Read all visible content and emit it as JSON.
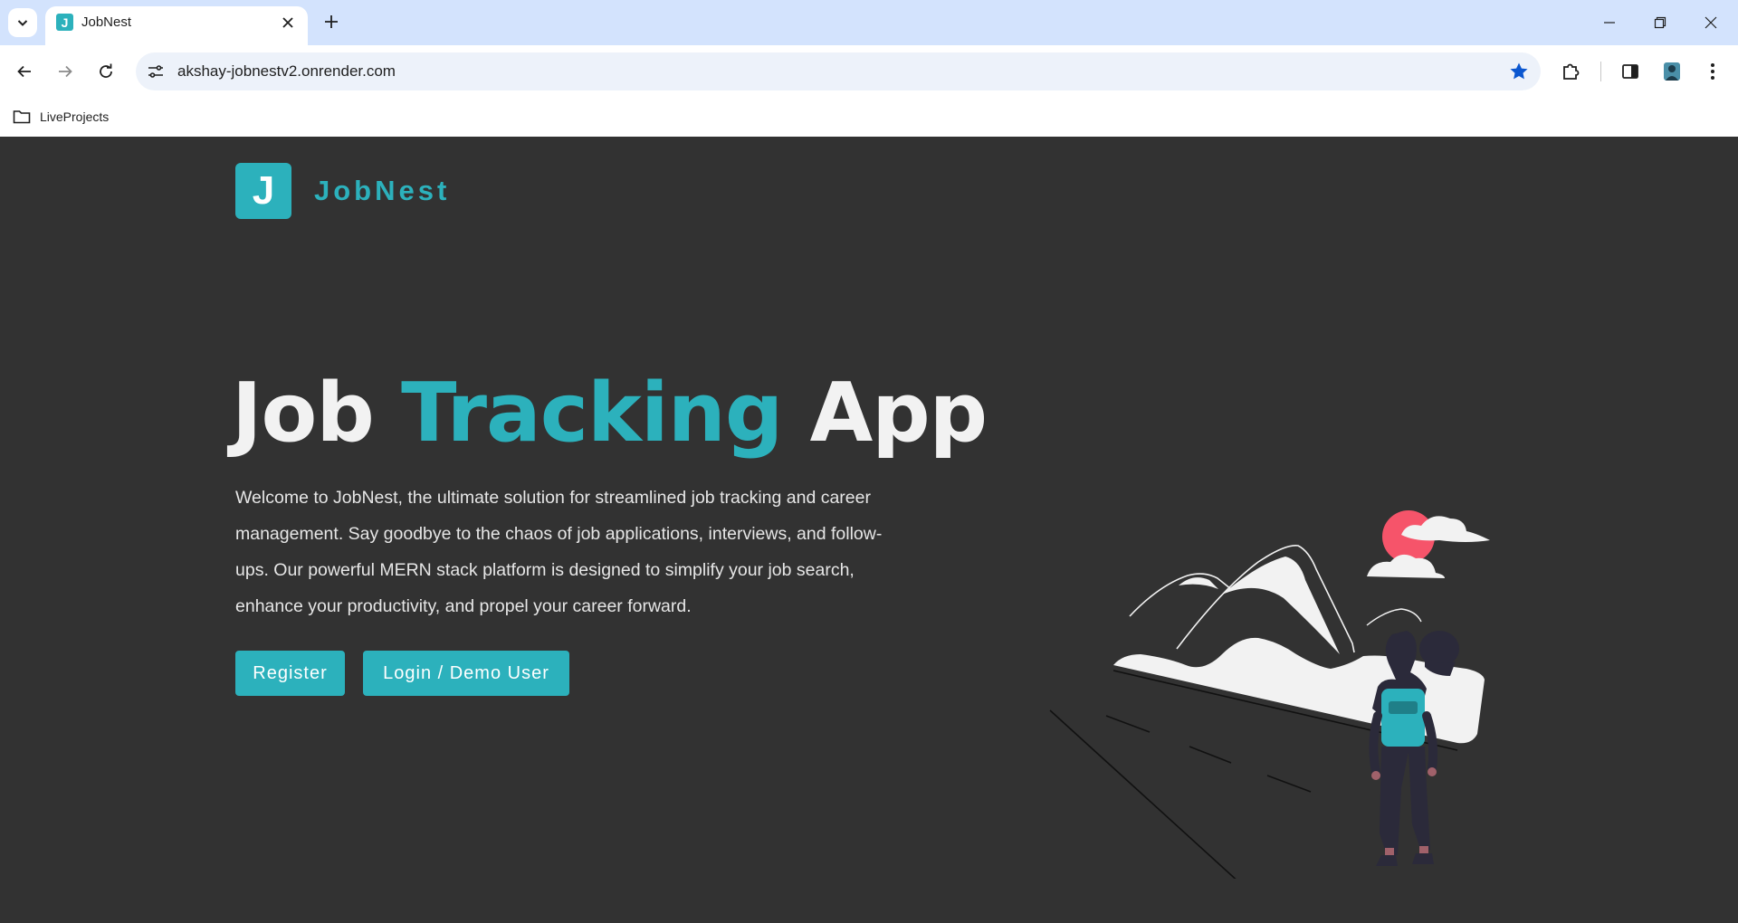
{
  "browser": {
    "tab_title": "JobNest",
    "tab_favicon_letter": "J",
    "url": "akshay-jobnestv2.onrender.com",
    "bookmark_folder": "LiveProjects"
  },
  "page": {
    "logo_letter": "J",
    "logo_text": "JobNest",
    "title_part1": "Job ",
    "title_accent": "Tracking",
    "title_part2": " App",
    "description": "Welcome to JobNest, the ultimate solution for streamlined job tracking and career management. Say goodbye to the chaos of job applications, interviews, and follow-ups. Our powerful MERN stack platform is designed to simplify your job search, enhance your productivity, and propel your career forward.",
    "register_label": "Register",
    "login_label": "Login / Demo User"
  },
  "colors": {
    "accent": "#2cb1bc",
    "background": "#323232",
    "sun": "#f6546a"
  },
  "icons": {
    "tab_search": "chevron-down-icon",
    "close": "close-icon",
    "new_tab": "plus-icon",
    "back": "arrow-left-icon",
    "forward": "arrow-right-icon",
    "reload": "reload-icon",
    "site_info": "tune-icon",
    "bookmark": "star-icon",
    "extensions": "puzzle-icon",
    "side_panel": "side-panel-icon",
    "menu": "kebab-menu-icon",
    "folder": "folder-icon"
  }
}
